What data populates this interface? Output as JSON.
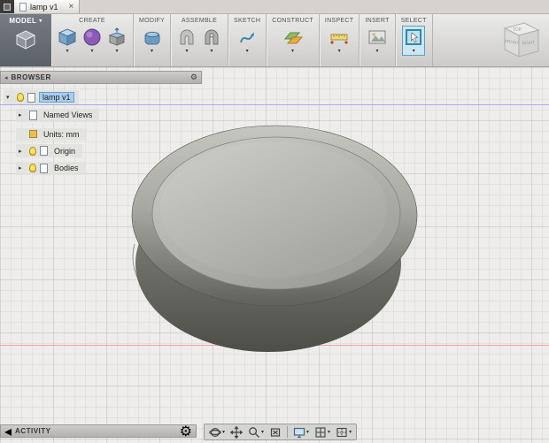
{
  "window": {
    "tab_title": "lamp v1",
    "close_glyph": "×"
  },
  "toolbar": {
    "workspace": {
      "label": "MODEL"
    },
    "groups": [
      {
        "label": "CREATE",
        "icons": [
          "box-primitive-icon",
          "form-sphere-icon",
          "extrude-icon"
        ]
      },
      {
        "label": "MODIFY",
        "icons": [
          "press-pull-icon"
        ]
      },
      {
        "label": "ASSEMBLE",
        "icons": [
          "new-component-icon",
          "joint-icon"
        ]
      },
      {
        "label": "SKETCH",
        "icons": [
          "create-sketch-icon"
        ]
      },
      {
        "label": "CONSTRUCT",
        "icons": [
          "construction-plane-icon"
        ]
      },
      {
        "label": "INSPECT",
        "icons": [
          "measure-icon"
        ]
      },
      {
        "label": "INSERT",
        "icons": [
          "insert-image-icon"
        ]
      },
      {
        "label": "SELECT",
        "icons": [
          "select-tool-icon"
        ]
      }
    ]
  },
  "viewcube": {
    "top": "TOP",
    "front": "FRONT",
    "right": "RIGHT"
  },
  "browser": {
    "title": "BROWSER",
    "collapse_glyph": "◂",
    "gear_glyph": "⚙",
    "items": [
      {
        "label": "lamp v1",
        "selected": true,
        "expanded": true
      },
      {
        "label": "Named Views",
        "expanded": false
      },
      {
        "label": "Units: mm"
      },
      {
        "label": "Origin",
        "expanded": false,
        "visible": true
      },
      {
        "label": "Bodies",
        "expanded": false,
        "visible": true
      }
    ]
  },
  "activity": {
    "title": "ACTIVITY",
    "gear_glyph": "⚙"
  },
  "navbar": {
    "icons": [
      "orbit-icon",
      "pan-icon",
      "zoom-icon",
      "zoom-fit-icon",
      "display-settings-icon",
      "grid-settings-icon",
      "viewports-icon"
    ]
  },
  "glyphs": {
    "expanded": "▾",
    "collapsed": "▸",
    "caret": "▾"
  },
  "colors": {
    "selection_highlight": "#a8cdf0",
    "select_tool_active": "#5aa0c8",
    "axis_x": "#f09a9a",
    "axis_z": "#9a9af0",
    "grid_line": "#d9d8d6",
    "canvas_bg": "#eeedeb",
    "workspace_bg": "#5a6167",
    "model_top": "#c8c8c4",
    "model_body": "#4f4f4a"
  }
}
